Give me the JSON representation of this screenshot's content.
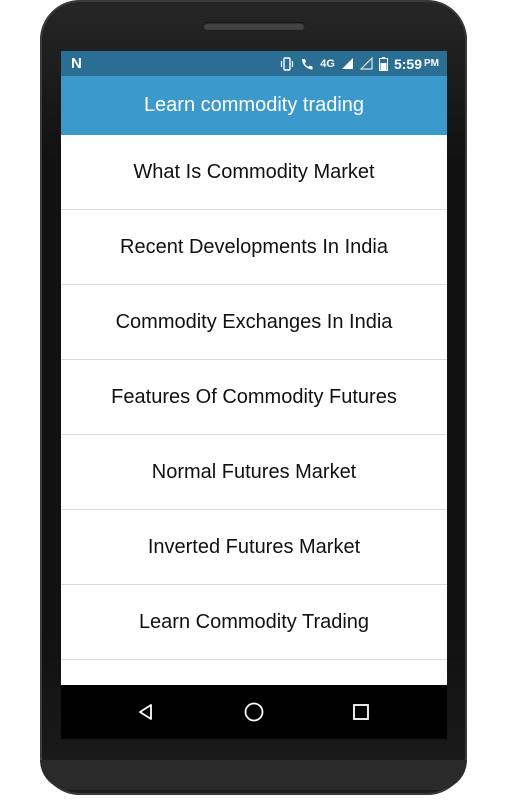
{
  "status_bar": {
    "left_icon": "n-notification-icon",
    "network": "4G",
    "time": "5:59",
    "ampm": "PM"
  },
  "app": {
    "title": "Learn commodity trading"
  },
  "topics": [
    "What Is Commodity Market",
    "Recent Developments In India",
    "Commodity Exchanges In India",
    "Features Of Commodity Futures",
    "Normal Futures Market",
    "Inverted Futures Market",
    "Learn Commodity Trading"
  ],
  "nav": {
    "back": "back-icon",
    "home": "home-icon",
    "recents": "recents-icon"
  },
  "colors": {
    "status_bar": "#2a6f93",
    "app_bar": "#3b99cc"
  }
}
